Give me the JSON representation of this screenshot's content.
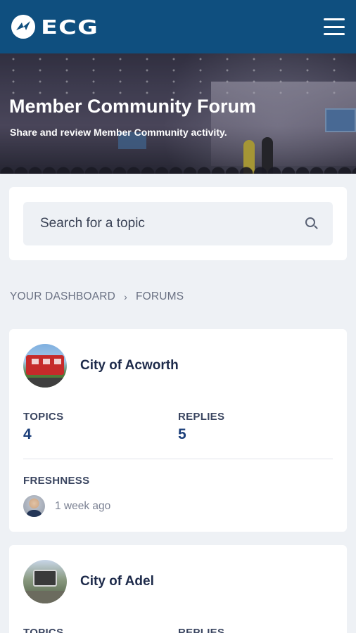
{
  "header": {
    "logo_text": "ECG",
    "menu_icon": "hamburger-menu-icon"
  },
  "hero": {
    "title": "Member Community Forum",
    "subtitle": "Share and review Member Community activity."
  },
  "search": {
    "placeholder": "Search for a topic",
    "icon": "search-icon"
  },
  "breadcrumb": {
    "items": [
      "YOUR DASHBOARD",
      "FORUMS"
    ],
    "separator": "›"
  },
  "forums": [
    {
      "name": "City of Acworth",
      "topics_label": "TOPICS",
      "topics": "4",
      "replies_label": "REPLIES",
      "replies": "5",
      "freshness_label": "FRESHNESS",
      "freshness": "1 week ago"
    },
    {
      "name": "City of Adel",
      "topics_label": "TOPICS",
      "replies_label": "REPLIES"
    }
  ],
  "colors": {
    "header_bg": "#0f4f7f",
    "page_bg": "#eef1f5",
    "stat_value": "#1c3f7a"
  }
}
